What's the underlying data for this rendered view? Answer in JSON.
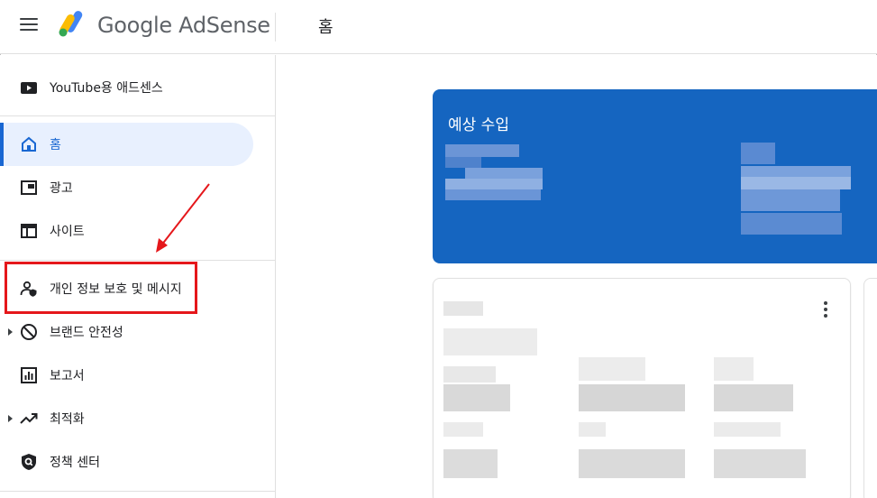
{
  "header": {
    "brand": "Google AdSense",
    "page_title": "홈"
  },
  "sidebar": {
    "items": [
      {
        "label": "YouTube용 애드센스",
        "icon": "youtube-icon"
      },
      {
        "label": "홈",
        "icon": "home-icon",
        "active": true
      },
      {
        "label": "광고",
        "icon": "ads-icon"
      },
      {
        "label": "사이트",
        "icon": "sites-icon"
      },
      {
        "label": "개인 정보 보호 및 메시지",
        "icon": "privacy-messaging-icon",
        "highlighted": true
      },
      {
        "label": "브랜드 안전성",
        "icon": "block-icon",
        "expandable": true
      },
      {
        "label": "보고서",
        "icon": "reports-icon"
      },
      {
        "label": "최적화",
        "icon": "trending-up-icon",
        "expandable": true
      },
      {
        "label": "정책 센터",
        "icon": "policy-shield-icon"
      }
    ]
  },
  "main": {
    "earnings_card": {
      "title": "예상 수입"
    }
  },
  "colors": {
    "accent": "#1967d2",
    "earnings_bg": "#1565c0",
    "active_bg": "#e8f0fe",
    "highlight": "#e5171b"
  }
}
